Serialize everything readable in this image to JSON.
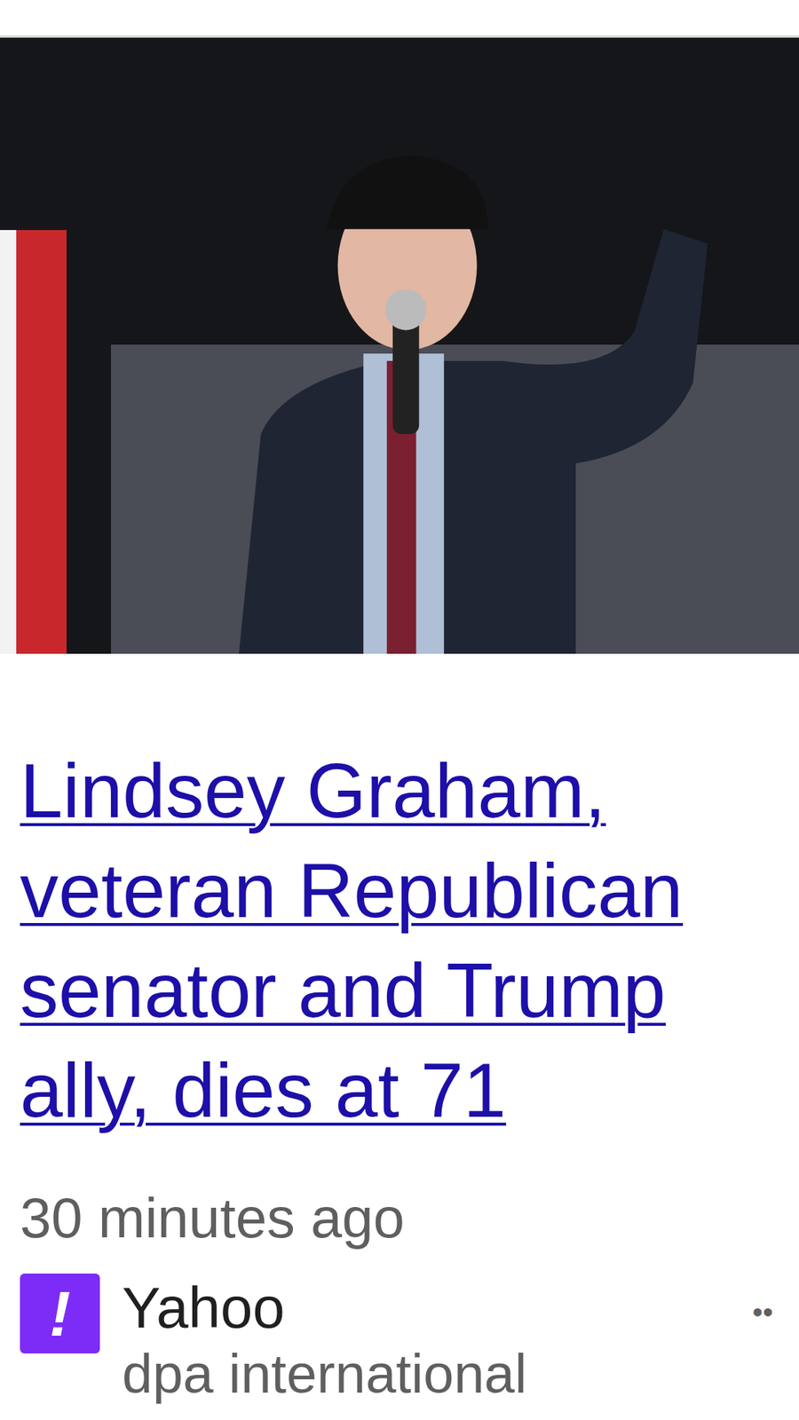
{
  "article": {
    "headline": "Lindsey Graham, veteran Republican senator and Trump ally, dies at 71",
    "time": "30 minutes ago",
    "source": {
      "logo_glyph": "!",
      "name": "Yahoo",
      "publisher": "dpa international"
    },
    "menu": "••"
  }
}
